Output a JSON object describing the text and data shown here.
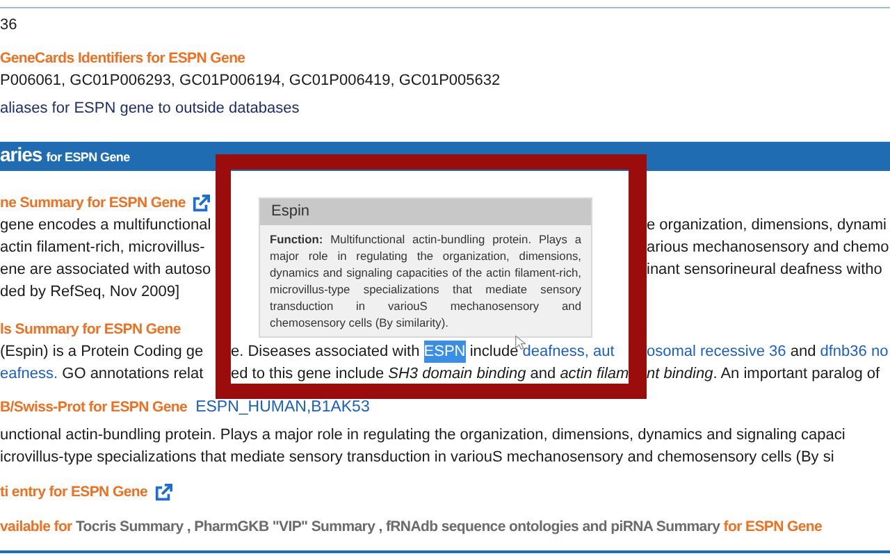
{
  "top_value": "36",
  "identifiers": {
    "heading": "GeneCards Identifiers for ESPN Gene",
    "ids": "P006061,  GC01P006293,  GC01P006194,  GC01P006419,  GC01P005632"
  },
  "aliases_link": "aliases for ESPN gene to outside databases",
  "section_bar": {
    "title": "aries",
    "subtitle": "for ESPN Gene"
  },
  "entrez_summary": {
    "heading": "ne Summary for ESPN Gene",
    "rows": [
      {
        "left": [
          {
            "kind": "text",
            "text": "gene encodes a multifunctional"
          }
        ],
        "right": [
          {
            "kind": "text",
            "text": "e organization, dimensions, dynami"
          }
        ]
      },
      {
        "left": [
          {
            "kind": "text",
            "text": "actin filament-rich, microvillus-"
          }
        ],
        "right": [
          {
            "kind": "text",
            "text": "arious mechanosensory and chemo"
          }
        ]
      },
      {
        "left": [
          {
            "kind": "text",
            "text": "ene are associated with autoso"
          }
        ],
        "right": [
          {
            "kind": "text",
            "text": "inant sensorineural deafness witho"
          }
        ]
      },
      {
        "left": [
          {
            "kind": "text",
            "text": "ded by RefSeq, Nov 2009]"
          }
        ]
      }
    ]
  },
  "genecards_summary": {
    "heading": "ls Summary for ESPN Gene",
    "rows": [
      {
        "left": [
          {
            "kind": "text",
            "text": "(Espin) is a Protein Coding ge"
          }
        ],
        "inner": [
          {
            "kind": "text",
            "text": "e. Diseases associated with "
          },
          {
            "kind": "highlight",
            "text": "ESPN"
          },
          {
            "kind": "text",
            "text": " include "
          },
          {
            "kind": "link",
            "text": "deafness, aut"
          }
        ],
        "right": [
          {
            "kind": "link",
            "text": "osomal recessive 36"
          },
          {
            "kind": "text",
            "text": " and "
          },
          {
            "kind": "link",
            "text": "dfnb36 no"
          }
        ]
      },
      {
        "left": [
          {
            "kind": "link",
            "text": "eafness."
          },
          {
            "kind": "text",
            "text": " GO annotations relat"
          }
        ],
        "inner": [
          {
            "kind": "text",
            "text": "ed to this gene include *SH3 domain binding* and *actin filam*"
          }
        ],
        "right": [
          {
            "kind": "text",
            "text": "*nt binding*. An important paralog of"
          }
        ]
      }
    ]
  },
  "uniprot": {
    "heading": "B/Swiss-Prot for ESPN Gene",
    "link": "ESPN_HUMAN,B1AK53",
    "lines": [
      "unctional actin-bundling protein. Plays a major role in regulating the organization, dimensions, dynamics and signaling capaci",
      "icrovillus-type specializations that mediate sensory transduction in variouS mechanosensory and chemosensory cells (By si"
    ]
  },
  "wiki_entry": {
    "heading": "ti entry for ESPN Gene"
  },
  "available": [
    {
      "kind": "heading",
      "text": "vailable for "
    },
    {
      "kind": "sources",
      "text": "Tocris Summary , PharmGKB \"VIP\" Summary , fRNAdb sequence ontologies and piRNA Summary"
    },
    {
      "kind": "heading",
      "text": " for ESPN Gene"
    }
  ],
  "tooltip": {
    "title": "Espin",
    "label": "Function:",
    "text": "Multifunctional actin-bundling protein. Plays a major role in regulating the organization, dimensions, dynamics and signaling capacities of the actin filament-rich, microvillus-type specializations that mediate sensory transduction in variouS mechanosensory and chemosensory cells (By similarity)."
  }
}
